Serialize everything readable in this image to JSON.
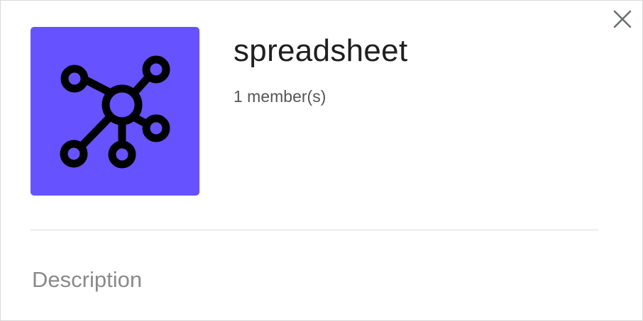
{
  "panel": {
    "title": "spreadsheet",
    "members": "1 member(s)",
    "description_label": "Description",
    "avatar_icon": "network-icon",
    "close_icon": "close-icon",
    "accent_color": "#6653ff"
  }
}
